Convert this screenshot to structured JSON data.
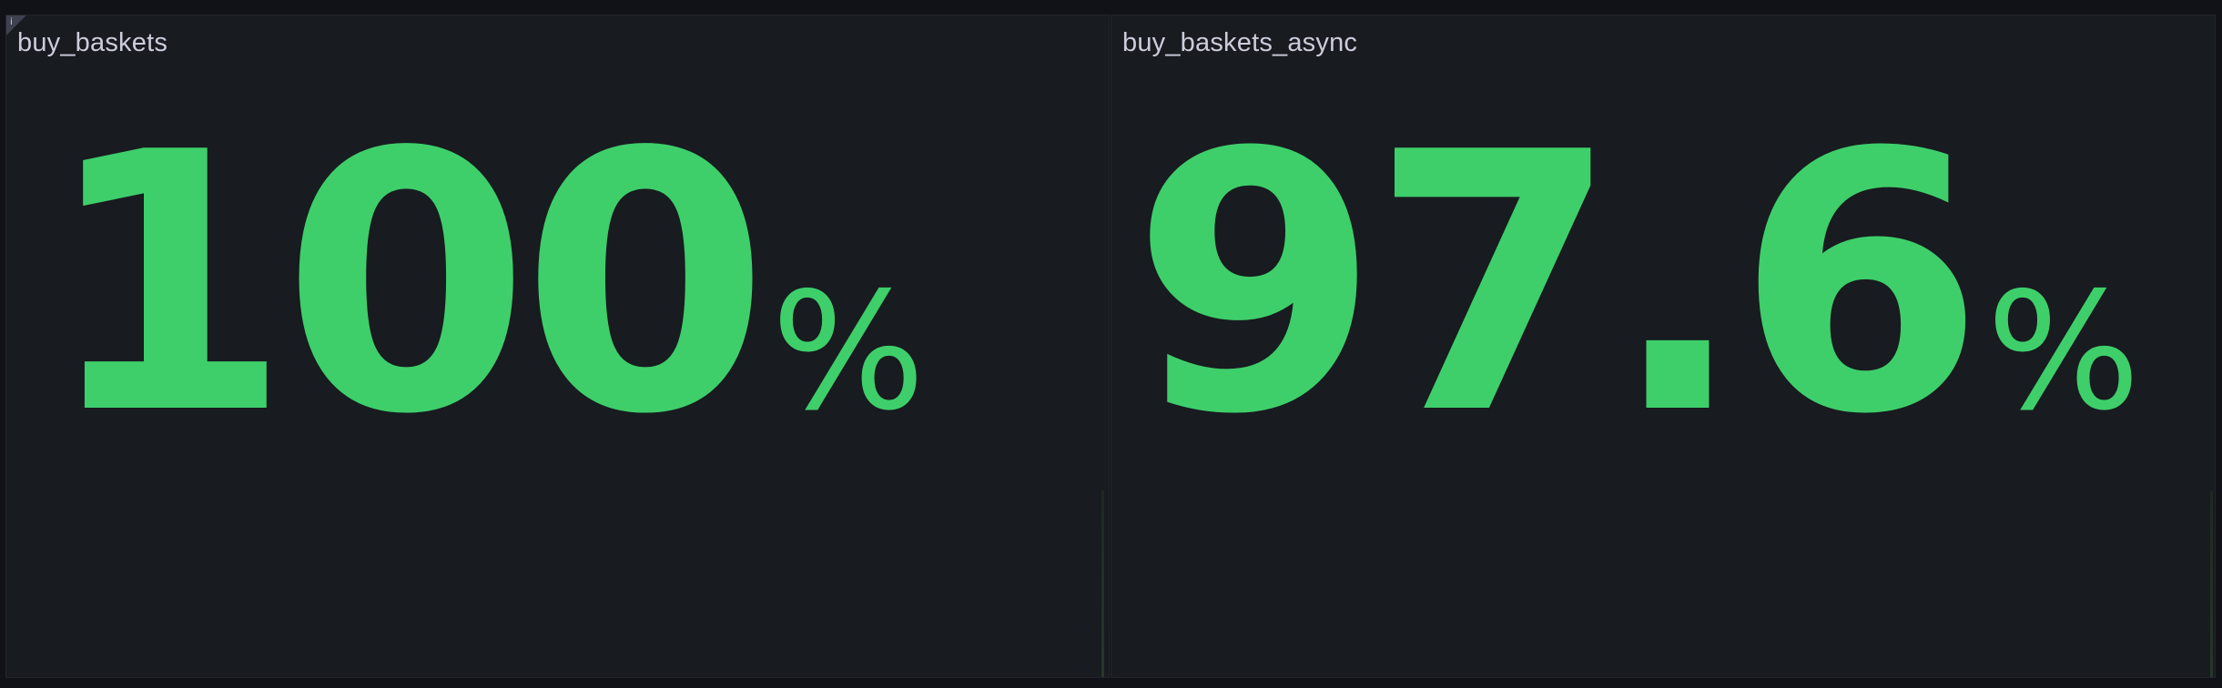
{
  "panels": [
    {
      "title": "buy_baskets",
      "value": "100",
      "unit": "%",
      "info_icon": "i",
      "color": "#3ecf6b"
    },
    {
      "title": "buy_baskets_async",
      "value": "97.6",
      "unit": "%",
      "color": "#3ecf6b"
    }
  ],
  "colors": {
    "background": "#111217",
    "panel_background": "#181b1f",
    "title": "#ccccdc",
    "stat_green": "#3ecf6b"
  }
}
